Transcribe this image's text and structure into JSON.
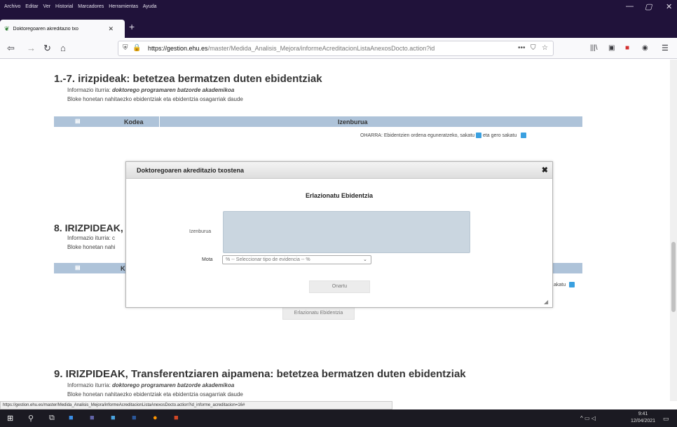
{
  "browser": {
    "menu": [
      "Archivo",
      "Editar",
      "Ver",
      "Historial",
      "Marcadores",
      "Herramientas",
      "Ayuda"
    ],
    "tab_title": "Doktoregoaren akreditazio txo",
    "url_host": "https://gestion.ehu.es",
    "url_path": "/master/Medida_Analisis_Mejora/informeAcreditacionListaAnexosDocto.action?id",
    "status_url": "https://gestion.ehu.es/master/Medida_Analisis_Mejora/informeAcreditacionListaAnexosDocto.action?id_informe_acreditacion=16#"
  },
  "section1": {
    "title": "1.-7. irizpideak: betetzea bermatzen duten ebidentziak",
    "source_label": "Informazio iturria:",
    "source_value": "doktorego programaren batzorde akademikoa",
    "desc": "Bloke honetan nahitaezko ebidentziak eta ebidentzia osagarriak daude",
    "col_kodea": "Kodea",
    "col_izenburua": "Izenburua",
    "note_a": "OHARRA: Ebidentzien ordena eguneratzeko, sakatu",
    "note_b": "eta gero sakatu"
  },
  "section8": {
    "title": "8. IRIZPIDEAK, N",
    "source_label": "Informazio iturria: c",
    "desc": "Bloke honetan nahi",
    "col_k": "K",
    "note_tail": "akatu",
    "button": "Erlazionatu Ebidentzia"
  },
  "section9": {
    "title": "9. IRIZPIDEAK, Transferentziaren aipamena: betetzea bermatzen duten ebidentziak",
    "source_label": "Informazio iturria:",
    "source_value": "doktorego programaren batzorde akademikoa",
    "desc": "Bloke honetan nahitaezko ebidentziak eta ebidentzia osagarriak daude"
  },
  "dialog": {
    "title": "Doktoregoaren akreditazio txostena",
    "heading": "Erlazionatu Ebidentzia",
    "label_izenburua": "Izenburua",
    "label_mota": "Mota",
    "select_value": "% -- Seleccionar tipo de evidencia -- %",
    "submit": "Onartu"
  },
  "taskbar": {
    "time": "9:41",
    "date": "12/04/2021"
  }
}
